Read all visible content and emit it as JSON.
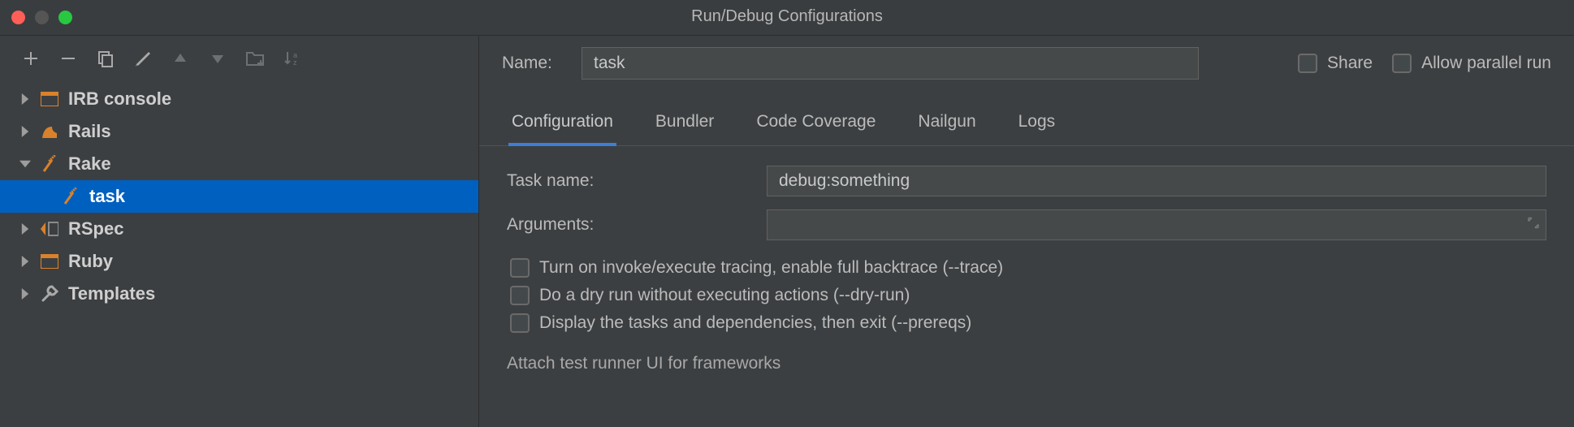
{
  "window": {
    "title": "Run/Debug Configurations"
  },
  "tree": [
    {
      "label": "IRB console",
      "icon": "irb",
      "expanded": false,
      "selected": false
    },
    {
      "label": "Rails",
      "icon": "rails",
      "expanded": false,
      "selected": false
    },
    {
      "label": "Rake",
      "icon": "rake",
      "expanded": true,
      "selected": false,
      "children": [
        {
          "label": "task",
          "icon": "rake",
          "selected": true
        }
      ]
    },
    {
      "label": "RSpec",
      "icon": "rspec",
      "expanded": false,
      "selected": false
    },
    {
      "label": "Ruby",
      "icon": "ruby",
      "expanded": false,
      "selected": false
    },
    {
      "label": "Templates",
      "icon": "templates",
      "expanded": false,
      "selected": false
    }
  ],
  "form": {
    "name_label": "Name:",
    "name_value": "task",
    "share_label": "Share",
    "parallel_label": "Allow parallel run",
    "tabs": [
      "Configuration",
      "Bundler",
      "Code Coverage",
      "Nailgun",
      "Logs"
    ],
    "active_tab": 0,
    "task_label": "Task name:",
    "task_value": "debug:something",
    "args_label": "Arguments:",
    "args_value": "",
    "checks": [
      "Turn on invoke/execute tracing, enable full backtrace (--trace)",
      "Do a dry run without executing actions (--dry-run)",
      "Display the tasks and dependencies, then exit (--prereqs)"
    ],
    "section_test_runner": "Attach test runner UI for frameworks"
  }
}
